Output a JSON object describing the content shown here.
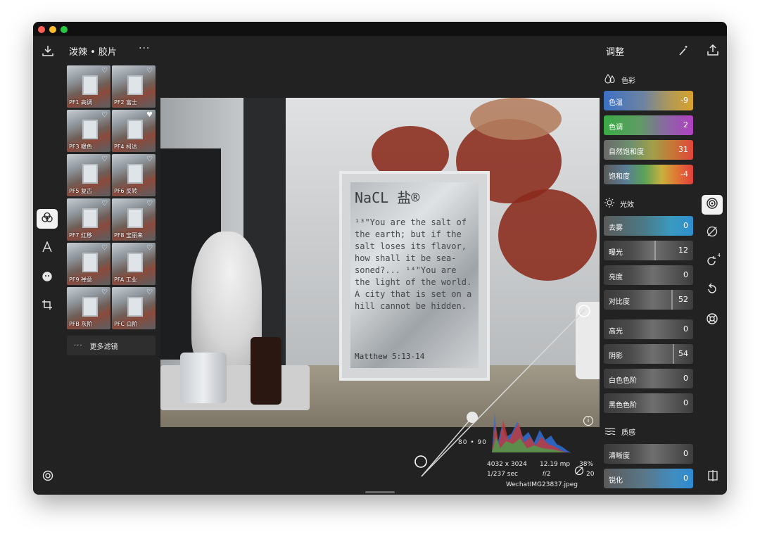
{
  "window": {
    "title": ""
  },
  "toolbar": {
    "album_title": "泼辣 • 胶片",
    "more": "···"
  },
  "filters": [
    {
      "label": "PF1 高调"
    },
    {
      "label": "PF2 富士"
    },
    {
      "label": "PF3 暖色"
    },
    {
      "label": "PF4 柯达"
    },
    {
      "label": "PF5 复古"
    },
    {
      "label": "PF6 反转"
    },
    {
      "label": "PF7 红移"
    },
    {
      "label": "PF8 宝丽来"
    },
    {
      "label": "PF9 禅意"
    },
    {
      "label": "PFA 工业"
    },
    {
      "label": "PFB 灰阶"
    },
    {
      "label": "PFC 白阶"
    }
  ],
  "more_filters": {
    "dots": "···",
    "label": "更多滤镜"
  },
  "photo": {
    "frame_head": "NaCL 盐®",
    "frame_text": "¹³\"You are the salt of the earth; but if the salt loses its flavor, how shall it be sea-soned?... ¹⁴\"You are the light of the world. A city that is set on a hill cannot be hidden.",
    "frame_ref": "Matthew 5:13-14"
  },
  "curve": {
    "label": "80 • 90"
  },
  "image_meta": {
    "dimensions": "4032 x 3024",
    "megapixels": "12.19 mp",
    "percent": "38%",
    "shutter": "1/237 sec",
    "aperture": "𝑓/2",
    "iso": "20",
    "filename": "WechatIMG23837.jpeg"
  },
  "panel": {
    "title": "调整",
    "sections": {
      "color": "色彩",
      "light": "光效",
      "texture": "质感"
    },
    "color_sliders": [
      {
        "label": "色温",
        "value": "-9"
      },
      {
        "label": "色调",
        "value": "2"
      },
      {
        "label": "自然饱和度",
        "value": "31"
      },
      {
        "label": "饱和度",
        "value": "-4"
      }
    ],
    "light_sliders": [
      {
        "label": "去雾",
        "value": "0"
      },
      {
        "label": "曝光",
        "value": "12"
      },
      {
        "label": "亮度",
        "value": "0"
      },
      {
        "label": "对比度",
        "value": "52"
      },
      {
        "label": "高光",
        "value": "0"
      },
      {
        "label": "阴影",
        "value": "54"
      },
      {
        "label": "白色色阶",
        "value": "0"
      },
      {
        "label": "黑色色阶",
        "value": "0"
      }
    ],
    "texture_sliders": [
      {
        "label": "清晰度",
        "value": "0"
      },
      {
        "label": "锐化",
        "value": "0"
      }
    ]
  },
  "rail": {
    "badge": "4"
  },
  "colors": {
    "window_bg": "#222222",
    "accent_white": "#f2f2f2",
    "temp_gradient": [
      "#3c73c7",
      "#d6a12a"
    ],
    "tint_gradient": [
      "#3caa46",
      "#b040c0"
    ],
    "vibrance_gradient": [
      "#7a7a7a",
      "#e24a3a"
    ],
    "saturation_gradient": [
      "#5a5a5a",
      "#e04030"
    ]
  }
}
